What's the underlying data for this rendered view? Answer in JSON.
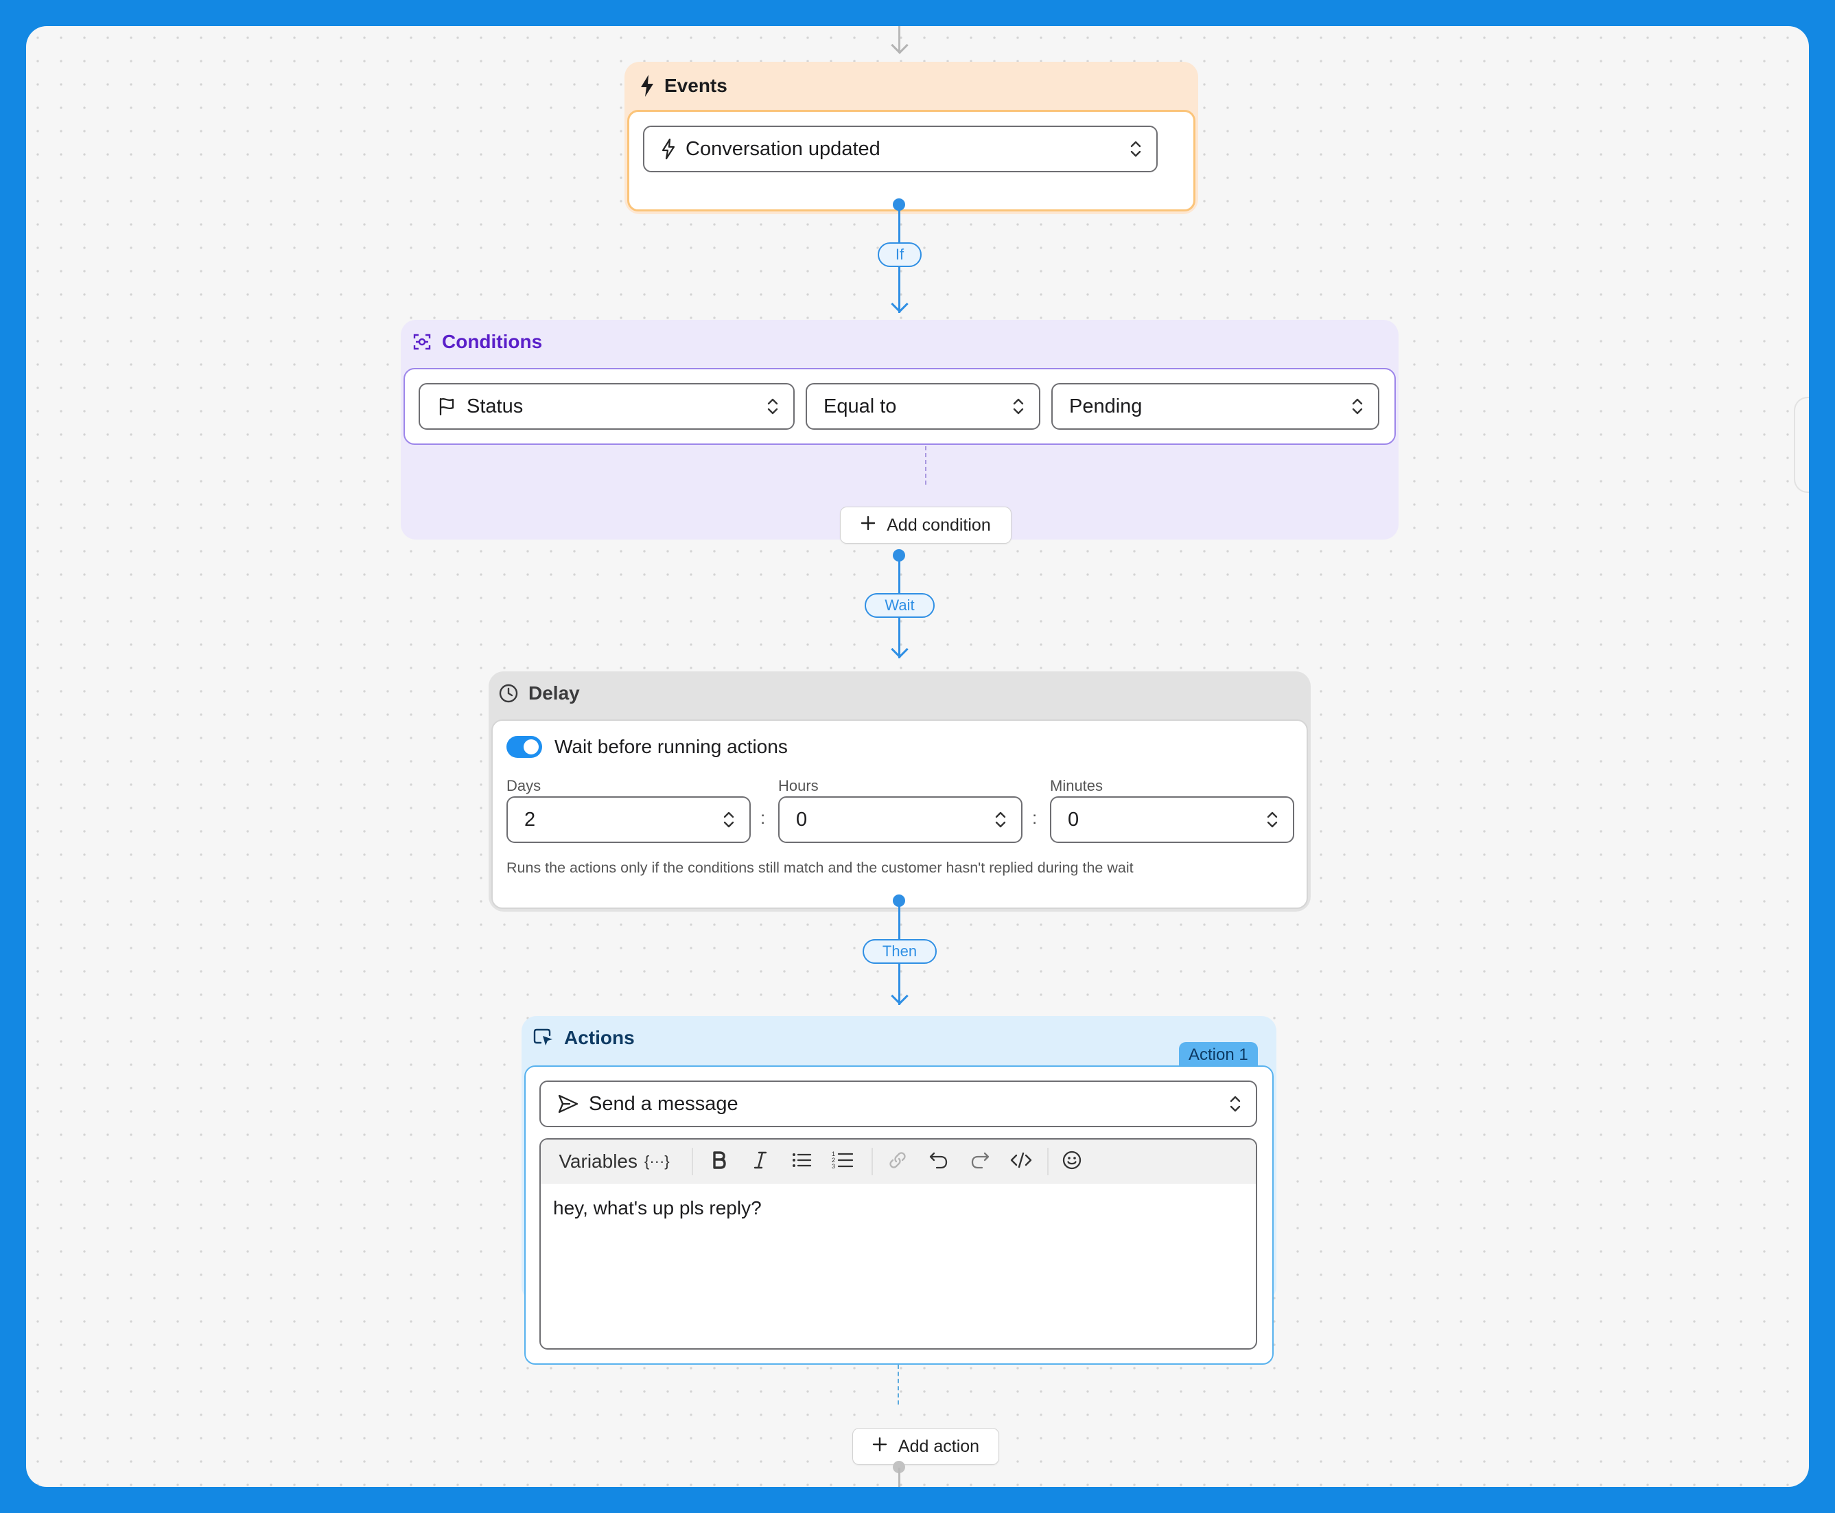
{
  "events": {
    "title": "Events",
    "selected_event": "Conversation updated",
    "icon": "lightning-bolt-icon"
  },
  "connectors": {
    "if_label": "If",
    "wait_label": "Wait",
    "then_label": "Then"
  },
  "conditions": {
    "title": "Conditions",
    "field": "Status",
    "operator": "Equal to",
    "value": "Pending",
    "add_label": "Add condition"
  },
  "delay": {
    "title": "Delay",
    "toggle_label": "Wait before running actions",
    "toggle_on": true,
    "days_label": "Days",
    "days_value": "2",
    "hours_label": "Hours",
    "hours_value": "0",
    "minutes_label": "Minutes",
    "minutes_value": "0",
    "separator": ":",
    "note": "Runs the actions only if the conditions still match and the customer hasn't replied during the wait"
  },
  "actions": {
    "title": "Actions",
    "badge": "Action 1",
    "action_type": "Send a message",
    "variables_label": "Variables",
    "variables_glyph": "{···}",
    "message": "hey, what's up pls reply?",
    "add_label": "Add action"
  },
  "colors": {
    "background": "#1388e3",
    "connector": "#2f8fe4",
    "events_panel": "#fde7d2",
    "conditions_panel": "#ede9fb",
    "conditions_accent": "#5a1fc9",
    "delay_panel": "#e2e2e2",
    "actions_panel": "#ddeffc",
    "actions_accent": "#0d3a63",
    "toggle": "#1d8ff0"
  }
}
